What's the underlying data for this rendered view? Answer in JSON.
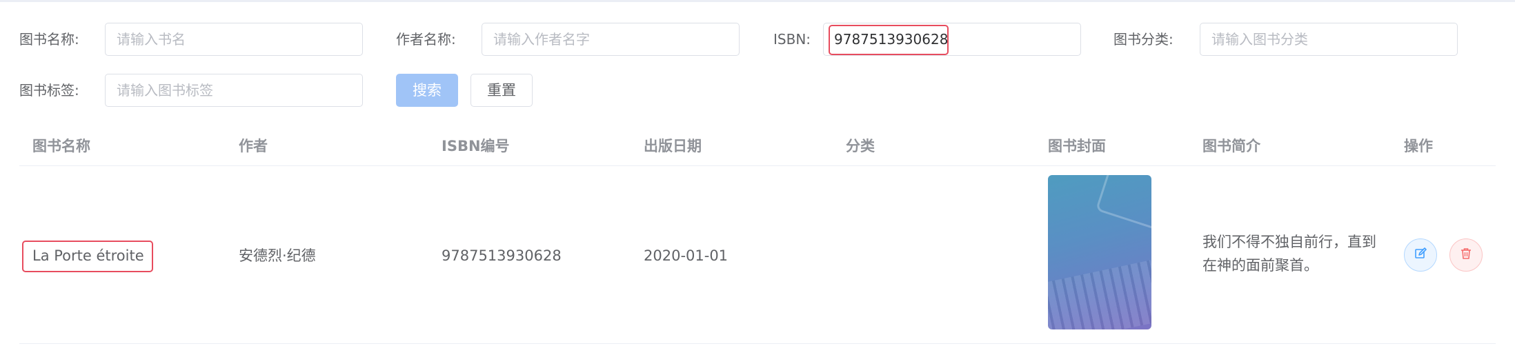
{
  "search_form": {
    "book_name": {
      "label": "图书名称:",
      "placeholder": "请输入书名",
      "value": ""
    },
    "author_name": {
      "label": "作者名称:",
      "placeholder": "请输入作者名字",
      "value": ""
    },
    "isbn": {
      "label": "ISBN:",
      "placeholder": "",
      "value": "9787513930628"
    },
    "category": {
      "label": "图书分类:",
      "placeholder": "请输入图书分类",
      "value": ""
    },
    "tag": {
      "label": "图书标签:",
      "placeholder": "请输入图书标签",
      "value": ""
    },
    "search_button": "搜索",
    "reset_button": "重置"
  },
  "table": {
    "headers": [
      "图书名称",
      "作者",
      "ISBN编号",
      "出版日期",
      "分类",
      "图书封面",
      "图书简介",
      "操作"
    ],
    "rows": [
      {
        "name": "La Porte étroite",
        "author": "安德烈·纪德",
        "isbn": "9787513930628",
        "publish_date": "2020-01-01",
        "category": "",
        "description": "我们不得不独自前行，直到在神的面前聚首。"
      }
    ]
  },
  "icons": {
    "edit": "edit-icon",
    "delete": "trash-icon"
  },
  "colors": {
    "primary_light": "#a0c4f7",
    "highlight": "#e74c5e",
    "edit_tint": "#409eff",
    "delete_tint": "#f56c6c"
  }
}
